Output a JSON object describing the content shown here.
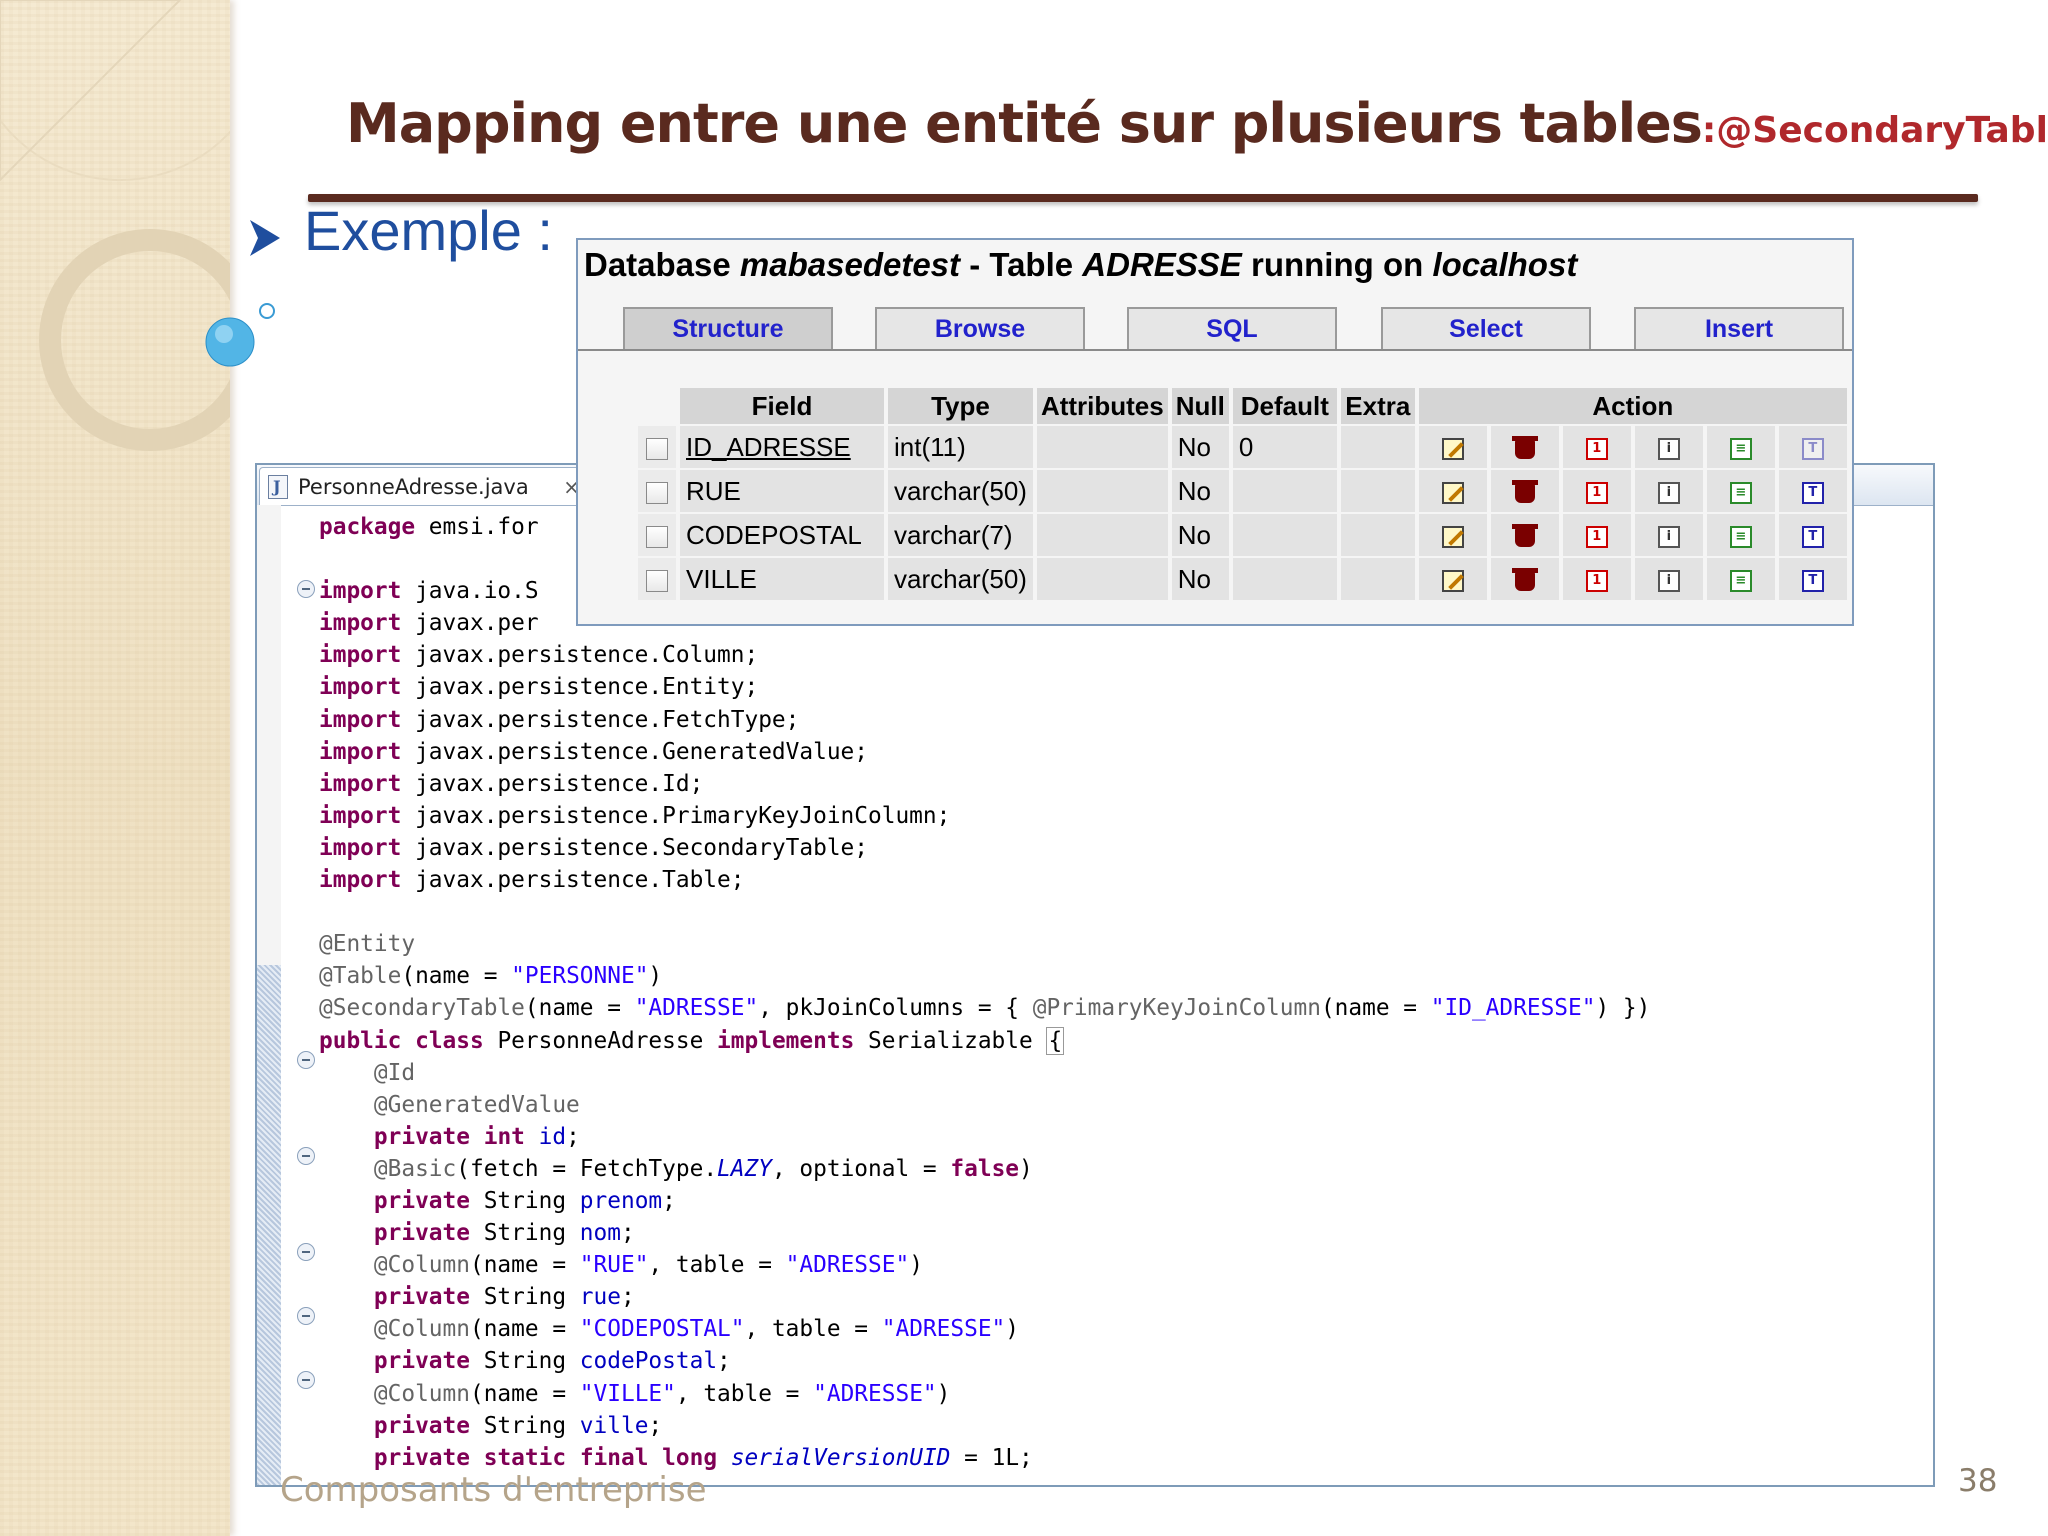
{
  "slide": {
    "title": "Mapping entre une entité sur plusieurs tables",
    "title_suffix": ":@SecondaryTable",
    "bullet": "Exemple :",
    "footer": "Composants d'entreprise",
    "page_number": "38",
    "colors": {
      "title": "#5a2a1f",
      "suffix": "#b0282c",
      "bullet": "#1f4e9e"
    }
  },
  "editor": {
    "tab_label": "PersonneAdresse.java",
    "tab_close": "×",
    "lines": [
      "package emsi.for",
      "",
      "import java.io.S",
      "import javax.per",
      "import javax.persistence.Column;",
      "import javax.persistence.Entity;",
      "import javax.persistence.FetchType;",
      "import javax.persistence.GeneratedValue;",
      "import javax.persistence.Id;",
      "import javax.persistence.PrimaryKeyJoinColumn;",
      "import javax.persistence.SecondaryTable;",
      "import javax.persistence.Table;",
      "",
      "@Entity",
      "@Table(name = \"PERSONNE\")",
      "@SecondaryTable(name = \"ADRESSE\", pkJoinColumns = { @PrimaryKeyJoinColumn(name = \"ID_ADRESSE\") })",
      "public class PersonneAdresse implements Serializable {",
      "    @Id",
      "    @GeneratedValue",
      "    private int id;",
      "    @Basic(fetch = FetchType.LAZY, optional = false)",
      "    private String prenom;",
      "    private String nom;",
      "    @Column(name = \"RUE\", table = \"ADRESSE\")",
      "    private String rue;",
      "    @Column(name = \"CODEPOSTAL\", table = \"ADRESSE\")",
      "    private String codePostal;",
      "    @Column(name = \"VILLE\", table = \"ADRESSE\")",
      "    private String ville;",
      "    private static final long serialVersionUID = 1L;"
    ]
  },
  "pma": {
    "title_parts": [
      "Database ",
      "mabasedetest",
      " - Table ",
      "ADRESSE",
      " running on ",
      "localhost"
    ],
    "tabs": [
      "Structure",
      "Browse",
      "SQL",
      "Select",
      "Insert"
    ],
    "active_tab": "Structure",
    "headers": [
      "Field",
      "Type",
      "Attributes",
      "Null",
      "Default",
      "Extra",
      "Action"
    ],
    "rows": [
      {
        "field": "ID_ADRESSE",
        "type": "int(11)",
        "attributes": "",
        "null": "No",
        "default": "0",
        "extra": ""
      },
      {
        "field": "RUE",
        "type": "varchar(50)",
        "attributes": "",
        "null": "No",
        "default": "",
        "extra": ""
      },
      {
        "field": "CODEPOSTAL",
        "type": "varchar(7)",
        "attributes": "",
        "null": "No",
        "default": "",
        "extra": ""
      },
      {
        "field": "VILLE",
        "type": "varchar(50)",
        "attributes": "",
        "null": "No",
        "default": "",
        "extra": ""
      }
    ],
    "action_icons": [
      "edit-icon",
      "drop-icon",
      "primary-key-icon",
      "unique-icon",
      "index-icon",
      "fulltext-icon"
    ]
  }
}
